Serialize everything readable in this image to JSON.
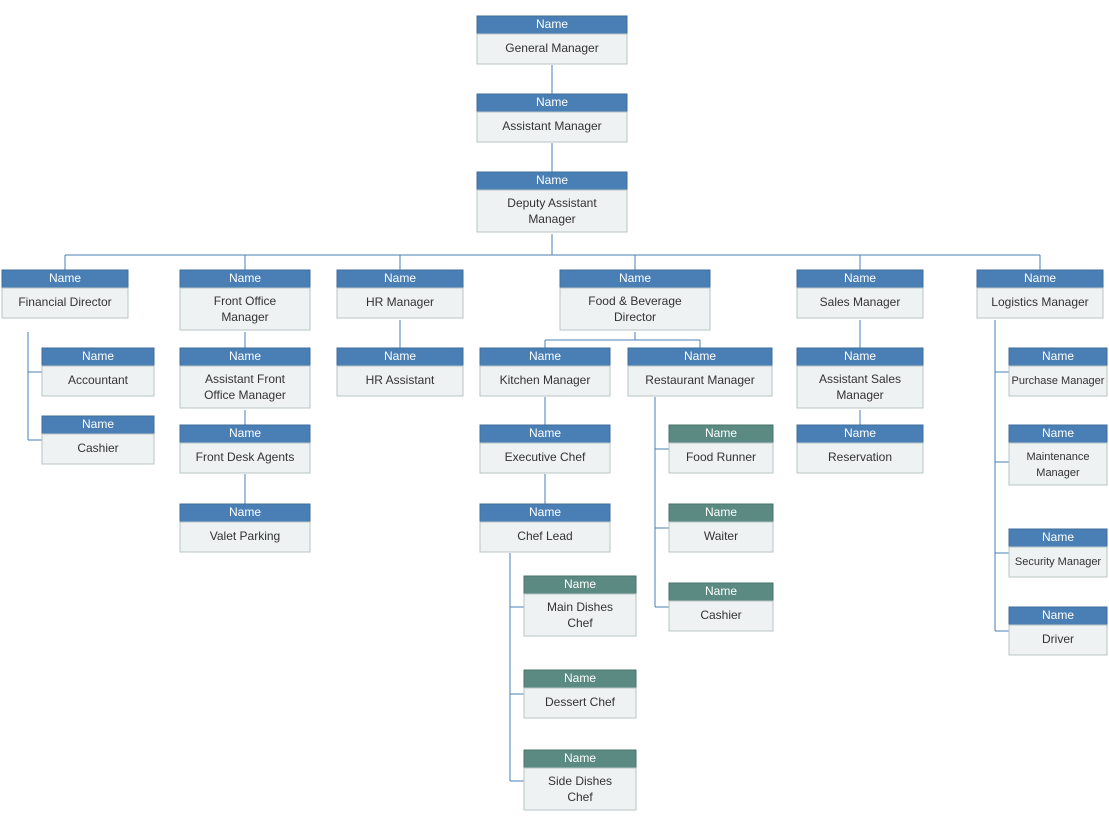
{
  "name_label": "Name",
  "colors": {
    "blue": "#4a7fb5",
    "green": "#5a8a82",
    "body": "#eef2f2"
  },
  "nodes": {
    "gm": {
      "title": "General Manager"
    },
    "am": {
      "title": "Assistant Manager"
    },
    "dam": {
      "title": "Deputy Assistant Manager"
    },
    "fin_dir": {
      "title": "Financial Director"
    },
    "fo_mgr": {
      "title": "Front Office Manager"
    },
    "hr_mgr": {
      "title": "HR Manager"
    },
    "fb_dir": {
      "title": "Food & Beverage Director"
    },
    "sales_mgr": {
      "title": "Sales Manager"
    },
    "log_mgr": {
      "title": "Logistics Manager"
    },
    "accountant": {
      "title": "Accountant"
    },
    "cashier_fin": {
      "title": "Cashier"
    },
    "afo_mgr": {
      "title": "Assistant Front Office Manager"
    },
    "desk_agents": {
      "title": "Front Desk Agents"
    },
    "valet": {
      "title": "Valet Parking"
    },
    "hr_asst": {
      "title": "HR Assistant"
    },
    "kitchen_mgr": {
      "title": "Kitchen Manager"
    },
    "rest_mgr": {
      "title": "Restaurant Manager"
    },
    "exec_chef": {
      "title": "Executive Chef"
    },
    "chef_lead": {
      "title": "Chef Lead"
    },
    "main_chef": {
      "title": "Main Dishes Chef"
    },
    "dessert_chef": {
      "title": "Dessert Chef"
    },
    "side_chef": {
      "title": "Side Dishes Chef"
    },
    "food_runner": {
      "title": "Food Runner"
    },
    "waiter": {
      "title": "Waiter"
    },
    "cashier_rest": {
      "title": "Cashier"
    },
    "asst_sales": {
      "title": "Assistant Sales Manager"
    },
    "reservation": {
      "title": "Reservation"
    },
    "purchase": {
      "title": "Purchase Manager"
    },
    "maint": {
      "title": "Maintenance Manager"
    },
    "security": {
      "title": "Security Manager"
    },
    "driver": {
      "title": "Driver"
    }
  }
}
